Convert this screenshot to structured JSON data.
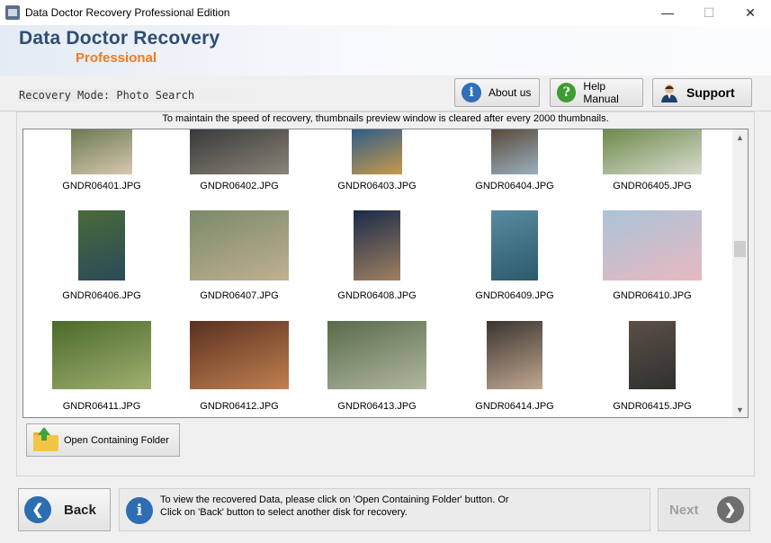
{
  "window": {
    "title": "Data Doctor Recovery Professional Edition",
    "minimize_glyph": "—",
    "maximize_glyph": "☐",
    "close_glyph": "✕"
  },
  "header": {
    "brand_main": "Data Doctor Recovery",
    "brand_sub": "Professional"
  },
  "toolbar": {
    "mode_label": "Recovery Mode: Photo Search",
    "about_label": "About us",
    "help_label": "Help Manual",
    "support_label": "Support",
    "about_icon": "info-icon",
    "help_icon": "question-icon",
    "support_icon": "support-agent-icon"
  },
  "notice": "To maintain the speed of recovery, thumbnails preview window is cleared after every 2000 thumbnails.",
  "gallery": {
    "items": [
      {
        "name": "GNDR06401.JPG",
        "colors": [
          "#6b7a52",
          "#d8c8b0"
        ]
      },
      {
        "name": "GNDR06402.JPG",
        "colors": [
          "#3a3a3a",
          "#8a8478"
        ]
      },
      {
        "name": "GNDR06403.JPG",
        "colors": [
          "#2f5c8a",
          "#c89a4a"
        ]
      },
      {
        "name": "GNDR06404.JPG",
        "colors": [
          "#5a4a3a",
          "#9ab0c0"
        ]
      },
      {
        "name": "GNDR06405.JPG",
        "colors": [
          "#6c8a4a",
          "#d8dcd0"
        ]
      },
      {
        "name": "GNDR06406.JPG",
        "colors": [
          "#4a6a3a",
          "#2a4a5a"
        ]
      },
      {
        "name": "GNDR06407.JPG",
        "colors": [
          "#7a8a6a",
          "#c0b090"
        ]
      },
      {
        "name": "GNDR06408.JPG",
        "colors": [
          "#1a2a4a",
          "#a08060"
        ]
      },
      {
        "name": "GNDR06409.JPG",
        "colors": [
          "#5a8aa0",
          "#2a5a6a"
        ]
      },
      {
        "name": "GNDR06410.JPG",
        "colors": [
          "#aac4d8",
          "#e8b8c0"
        ]
      },
      {
        "name": "GNDR06411.JPG",
        "colors": [
          "#4a6a2a",
          "#a0b070"
        ]
      },
      {
        "name": "GNDR06412.JPG",
        "colors": [
          "#5a3020",
          "#c08050"
        ]
      },
      {
        "name": "GNDR06413.JPG",
        "colors": [
          "#5a6a4a",
          "#b0b8a0"
        ]
      },
      {
        "name": "GNDR06414.JPG",
        "colors": [
          "#3a3430",
          "#c0a890"
        ]
      },
      {
        "name": "GNDR06415.JPG",
        "colors": [
          "#5a5048",
          "#30302e"
        ]
      }
    ]
  },
  "folder_button": {
    "label": "Open Containing Folder",
    "icon": "folder-up-icon"
  },
  "footer": {
    "back_label": "Back",
    "next_label": "Next",
    "info_line1": "To view the recovered Data, please click on 'Open Containing Folder' button. Or",
    "info_line2": "Click on 'Back' button to select another disk for recovery.",
    "back_icon": "arrow-left-icon",
    "next_icon": "arrow-right-icon",
    "info_icon": "info-icon"
  },
  "colors": {
    "brand_blue": "#2f4d75",
    "brand_orange": "#f07b20",
    "button_blue": "#2d6db2"
  }
}
